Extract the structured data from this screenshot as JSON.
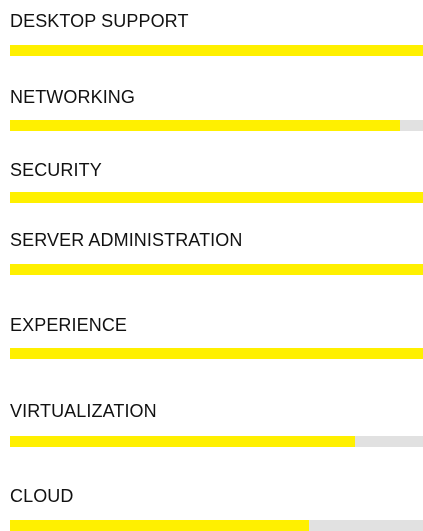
{
  "colors": {
    "bar_fill": "#fff000",
    "bar_track": "#e1e1e1",
    "text": "#111111",
    "background": "#ffffff"
  },
  "skills": [
    {
      "label": "DESKTOP SUPPORT",
      "percent": 100
    },
    {
      "label": "NETWORKING",
      "percent": 94.5
    },
    {
      "label": "SECURITY",
      "percent": 100
    },
    {
      "label": "SERVER ADMINISTRATION",
      "percent": 100
    },
    {
      "label": "EXPERIENCE",
      "percent": 100
    },
    {
      "label": "VIRTUALIZATION",
      "percent": 83.5
    },
    {
      "label": "CLOUD",
      "percent": 72.5
    }
  ]
}
